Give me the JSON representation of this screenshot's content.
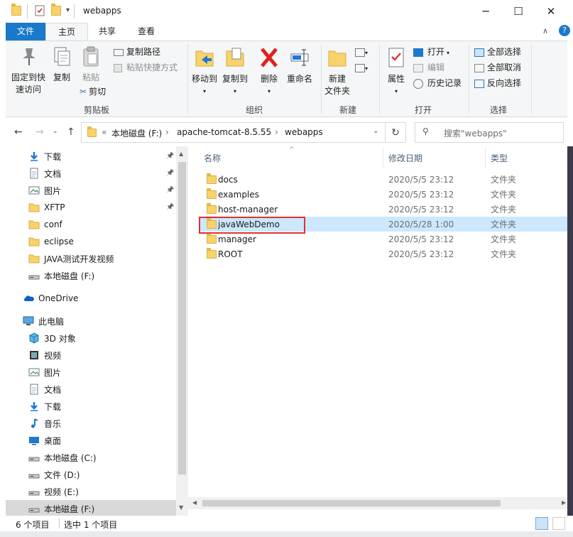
{
  "window": {
    "title": "webapps",
    "controls": {
      "minimize": "─",
      "maximize": "☐",
      "close": "✕"
    }
  },
  "ribbon_tabs": [
    "文件",
    "主页",
    "共享",
    "查看"
  ],
  "ribbon": {
    "clipboard": {
      "pin_label_1": "固定到快",
      "pin_label_2": "速访问",
      "copy": "复制",
      "paste": "粘贴",
      "copy_path": "复制路径",
      "paste_shortcut": "粘贴快捷方式",
      "cut": "剪切",
      "group": "剪贴板"
    },
    "organize": {
      "move_to": "移动到",
      "copy_to": "复制到",
      "delete": "删除",
      "rename": "重命名",
      "group": "组织"
    },
    "new": {
      "new_folder_1": "新建",
      "new_folder_2": "文件夹",
      "group": "新建"
    },
    "open": {
      "properties": "属性",
      "open": "打开",
      "edit": "编辑",
      "history": "历史记录",
      "group": "打开"
    },
    "select": {
      "select_all": "全部选择",
      "select_none": "全部取消",
      "invert": "反向选择",
      "group": "选择"
    }
  },
  "address": {
    "prefix": "«",
    "crumbs": [
      "本地磁盘 (F:)",
      "apache-tomcat-8.5.55",
      "webapps"
    ],
    "search_placeholder": "搜索\"webapps\""
  },
  "nav_pane": {
    "quick_access": [
      {
        "label": "下载",
        "icon": "download-icon",
        "pinned": true
      },
      {
        "label": "文档",
        "icon": "document-icon",
        "pinned": true
      },
      {
        "label": "图片",
        "icon": "picture-icon",
        "pinned": true
      },
      {
        "label": "XFTP",
        "icon": "folder-icon",
        "pinned": true
      },
      {
        "label": "conf",
        "icon": "folder-icon",
        "pinned": false
      },
      {
        "label": "eclipse",
        "icon": "folder-icon",
        "pinned": false
      },
      {
        "label": "JAVA测试开发视频",
        "icon": "folder-icon",
        "pinned": false
      },
      {
        "label": "本地磁盘 (F:)",
        "icon": "drive-icon",
        "pinned": false
      }
    ],
    "onedrive": "OneDrive",
    "this_pc": "此电脑",
    "pc_items": [
      {
        "label": "3D 对象",
        "icon": "cube-icon"
      },
      {
        "label": "视频",
        "icon": "video-icon"
      },
      {
        "label": "图片",
        "icon": "picture-icon"
      },
      {
        "label": "文档",
        "icon": "document-icon"
      },
      {
        "label": "下载",
        "icon": "download-icon"
      },
      {
        "label": "音乐",
        "icon": "music-icon"
      },
      {
        "label": "桌面",
        "icon": "desktop-icon"
      },
      {
        "label": "本地磁盘 (C:)",
        "icon": "drive-icon"
      },
      {
        "label": "文件 (D:)",
        "icon": "drive-icon"
      },
      {
        "label": "视频 (E:)",
        "icon": "drive-icon"
      },
      {
        "label": "本地磁盘 (F:)",
        "icon": "drive-icon"
      }
    ]
  },
  "file_list": {
    "columns": [
      "名称",
      "修改日期",
      "类型"
    ],
    "rows": [
      {
        "name": "docs",
        "date": "2020/5/5 23:12",
        "type": "文件夹"
      },
      {
        "name": "examples",
        "date": "2020/5/5 23:12",
        "type": "文件夹"
      },
      {
        "name": "host-manager",
        "date": "2020/5/5 23:12",
        "type": "文件夹"
      },
      {
        "name": "javaWebDemo",
        "date": "2020/5/28 1:00",
        "type": "文件夹"
      },
      {
        "name": "manager",
        "date": "2020/5/5 23:12",
        "type": "文件夹"
      },
      {
        "name": "ROOT",
        "date": "2020/5/5 23:12",
        "type": "文件夹"
      }
    ],
    "selected_row": 3
  },
  "status": {
    "count": "6 个项目",
    "selected": "选中 1 个项目"
  },
  "colors": {
    "file_tab": "#1979ca",
    "selection": "#cce8ff",
    "highlight_box": "#e03030"
  }
}
